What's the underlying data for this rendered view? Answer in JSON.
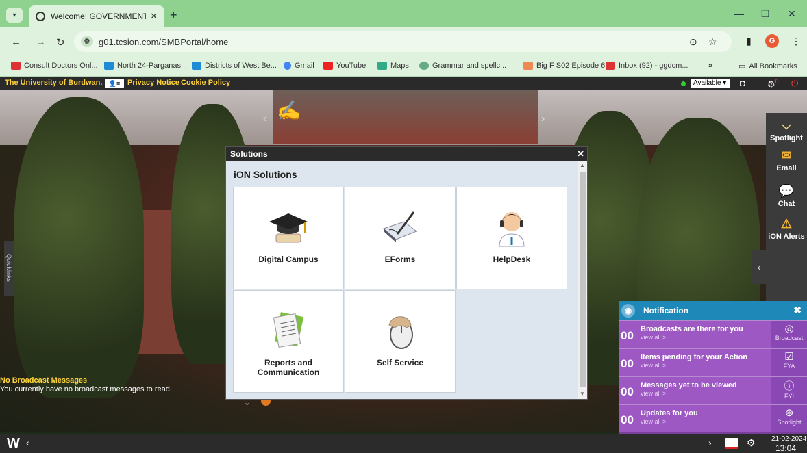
{
  "browser": {
    "tab_title": "Welcome: GOVERNMENT GENE",
    "url": "g01.tcsion.com/SMBPortal/home",
    "avatar_letter": "G",
    "bookmarks": [
      "Consult Doctors Onl...",
      "North 24-Parganas...",
      "Districts of West Be...",
      "Gmail",
      "YouTube",
      "Maps",
      "Grammar and spellc...",
      "Big F S02 Episode 6...",
      "Inbox (92) - ggdcm...",
      "All Bookmarks"
    ],
    "more": "»"
  },
  "portal": {
    "university": "The University of Burdwan.",
    "privacy": "Privacy Notice",
    "cookie": "Cookie Policy",
    "status": "Available",
    "alert_count": "0"
  },
  "quicklinks": "Quicklinks",
  "sidebar": {
    "items": [
      "Spotlight",
      "Email",
      "Chat",
      "iON Alerts"
    ]
  },
  "dialog": {
    "title": "Solutions",
    "subtitle": "iON Solutions",
    "tiles": [
      "Digital Campus",
      "EForms",
      "HelpDesk",
      "Reports and Communication",
      "Self Service"
    ]
  },
  "broadcast": {
    "title": "No Broadcast Messages",
    "text": "You currently have no broadcast messages to read."
  },
  "notification": {
    "title": "Notification",
    "rows": [
      {
        "count": "00",
        "message": "Broadcasts are there for you",
        "link": "view all >",
        "label": "Broadcast"
      },
      {
        "count": "00",
        "message": "Items pending for your Action",
        "link": "view all >",
        "label": "FYA"
      },
      {
        "count": "00",
        "message": "Messages yet to be viewed",
        "link": "view all >",
        "label": "FYI"
      },
      {
        "count": "00",
        "message": "Updates for you",
        "link": "view all >",
        "label": "Spotlight"
      }
    ]
  },
  "taskbar": {
    "date": "21-02-2024",
    "time": "13:04"
  },
  "colors": {
    "accent_yellow": "#ffd43a",
    "notification_purple": "#9d58c4",
    "notification_blue": "#1e88b8",
    "browser_green": "#8fd18f"
  }
}
